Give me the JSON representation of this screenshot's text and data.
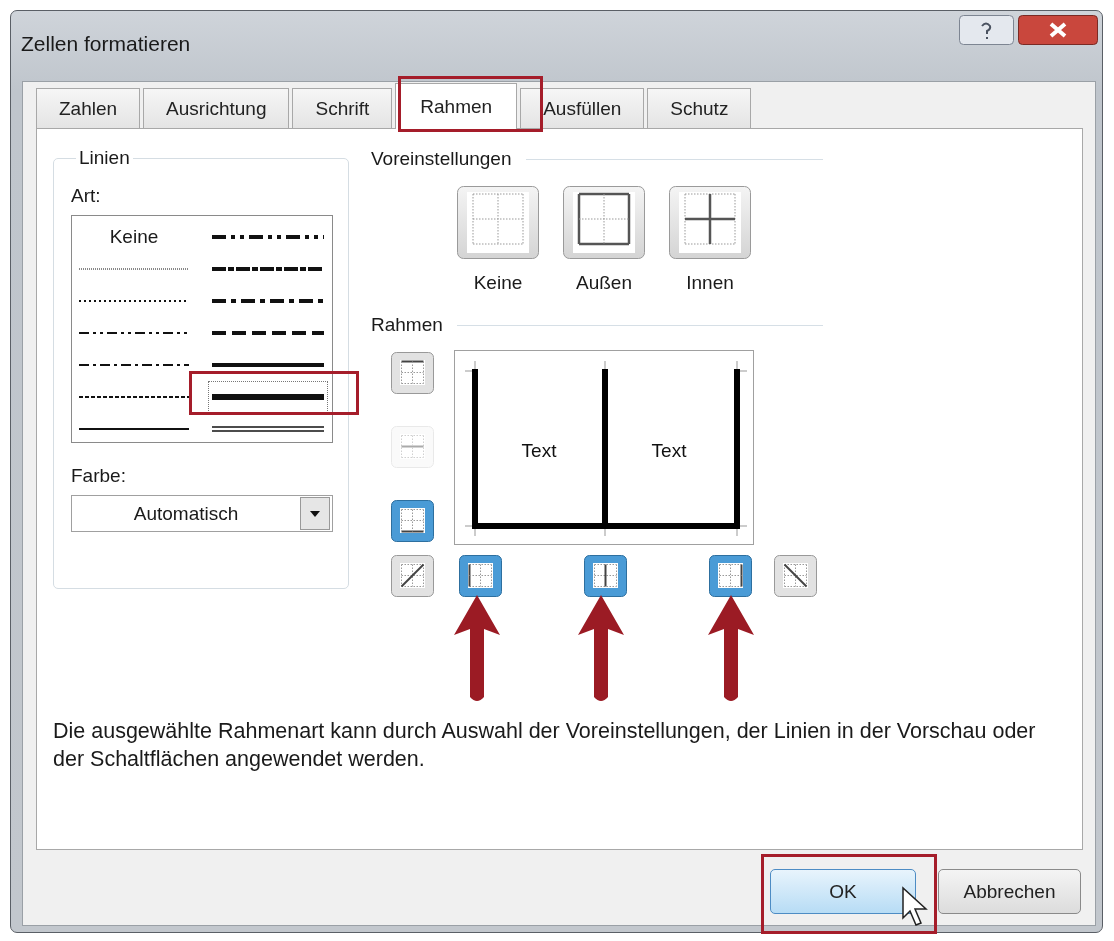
{
  "window": {
    "title": "Zellen formatieren"
  },
  "tabs": [
    {
      "label": "Zahlen",
      "selected": false
    },
    {
      "label": "Ausrichtung",
      "selected": false
    },
    {
      "label": "Schrift",
      "selected": false
    },
    {
      "label": "Rahmen",
      "selected": true
    },
    {
      "label": "Ausfüllen",
      "selected": false
    },
    {
      "label": "Schutz",
      "selected": false
    }
  ],
  "lines_group": {
    "title": "Linien",
    "style_label": "Art:",
    "color_label": "Farbe:",
    "color_value": "Automatisch",
    "styles": [
      {
        "kind": "none",
        "label": "Keine",
        "selected": false
      },
      {
        "kind": "hair",
        "selected": false
      },
      {
        "kind": "dotted",
        "selected": false
      },
      {
        "kind": "dashdotdot_thin",
        "selected": false
      },
      {
        "kind": "dashdot_thin",
        "selected": false
      },
      {
        "kind": "dashed_thin",
        "selected": false
      },
      {
        "kind": "thin",
        "selected": false
      },
      {
        "kind": "dashdotdot_medium",
        "selected": false
      },
      {
        "kind": "slantdashdot",
        "selected": false
      },
      {
        "kind": "dashdot_medium",
        "selected": false
      },
      {
        "kind": "dashed_medium",
        "selected": false
      },
      {
        "kind": "medium",
        "selected": false
      },
      {
        "kind": "thick",
        "selected": true
      },
      {
        "kind": "double",
        "selected": false
      }
    ]
  },
  "presets": {
    "title": "Voreinstellungen",
    "items": [
      {
        "kind": "none",
        "label": "Keine"
      },
      {
        "kind": "outline",
        "label": "Außen"
      },
      {
        "kind": "inside",
        "label": "Innen"
      }
    ]
  },
  "borders": {
    "title": "Rahmen",
    "preview_texts": [
      "Text",
      "Text"
    ],
    "buttons": [
      {
        "kind": "top",
        "selected": false,
        "disabled": false
      },
      {
        "kind": "middle_h",
        "selected": false,
        "disabled": true
      },
      {
        "kind": "bottom",
        "selected": true,
        "disabled": false
      },
      {
        "kind": "diag_up",
        "selected": false,
        "disabled": false
      },
      {
        "kind": "left",
        "selected": true,
        "disabled": false
      },
      {
        "kind": "middle_v",
        "selected": true,
        "disabled": false
      },
      {
        "kind": "right",
        "selected": true,
        "disabled": false
      },
      {
        "kind": "diag_down",
        "selected": false,
        "disabled": false
      }
    ]
  },
  "description": "Die ausgewählte Rahmenart kann durch Auswahl der Voreinstellungen, der Linien in der Vorschau oder der Schaltflächen angewendet werden.",
  "buttons": [
    {
      "label": "OK",
      "default": true
    },
    {
      "label": "Abbrechen",
      "default": false
    }
  ]
}
